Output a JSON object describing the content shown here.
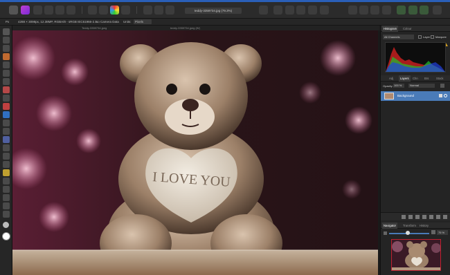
{
  "toolbar": {
    "document_title": "teddy-3359734.jpg (79.3%)"
  },
  "context_bar": {
    "size_label": "Px",
    "info": "4288 × 3098px, 12.38MP, RGBA/8 - sRGB IEC61966-2.1",
    "camera": "No Camera Data",
    "units_label": "Units:",
    "units_value": "Pixels"
  },
  "document": {
    "tab_left": "Teddy-3359734.jpeg",
    "tab_center": "teddy-3359734.jpeg (W)",
    "heart_text": "I LOVE YOU"
  },
  "histogram_panel": {
    "tabs": [
      "Histogram",
      "Colour"
    ],
    "channels": "All Channels",
    "layer_label": "Layer",
    "marquee_label": "Marquee"
  },
  "layers_panel": {
    "tabs": [
      "Adj",
      "Layers",
      "Chn",
      "Brs",
      "Stock"
    ],
    "opacity_label": "Opacity:",
    "opacity_value": "100 %",
    "blend_mode": "Normal",
    "layer_name": "Background"
  },
  "navigator_panel": {
    "tabs": [
      "Navigator",
      "Transform",
      "History"
    ],
    "zoom_value": "75 %"
  },
  "colors": {
    "accent": "#2a5fb8",
    "selected_layer": "#4a7bb8",
    "panel": "#242424"
  }
}
